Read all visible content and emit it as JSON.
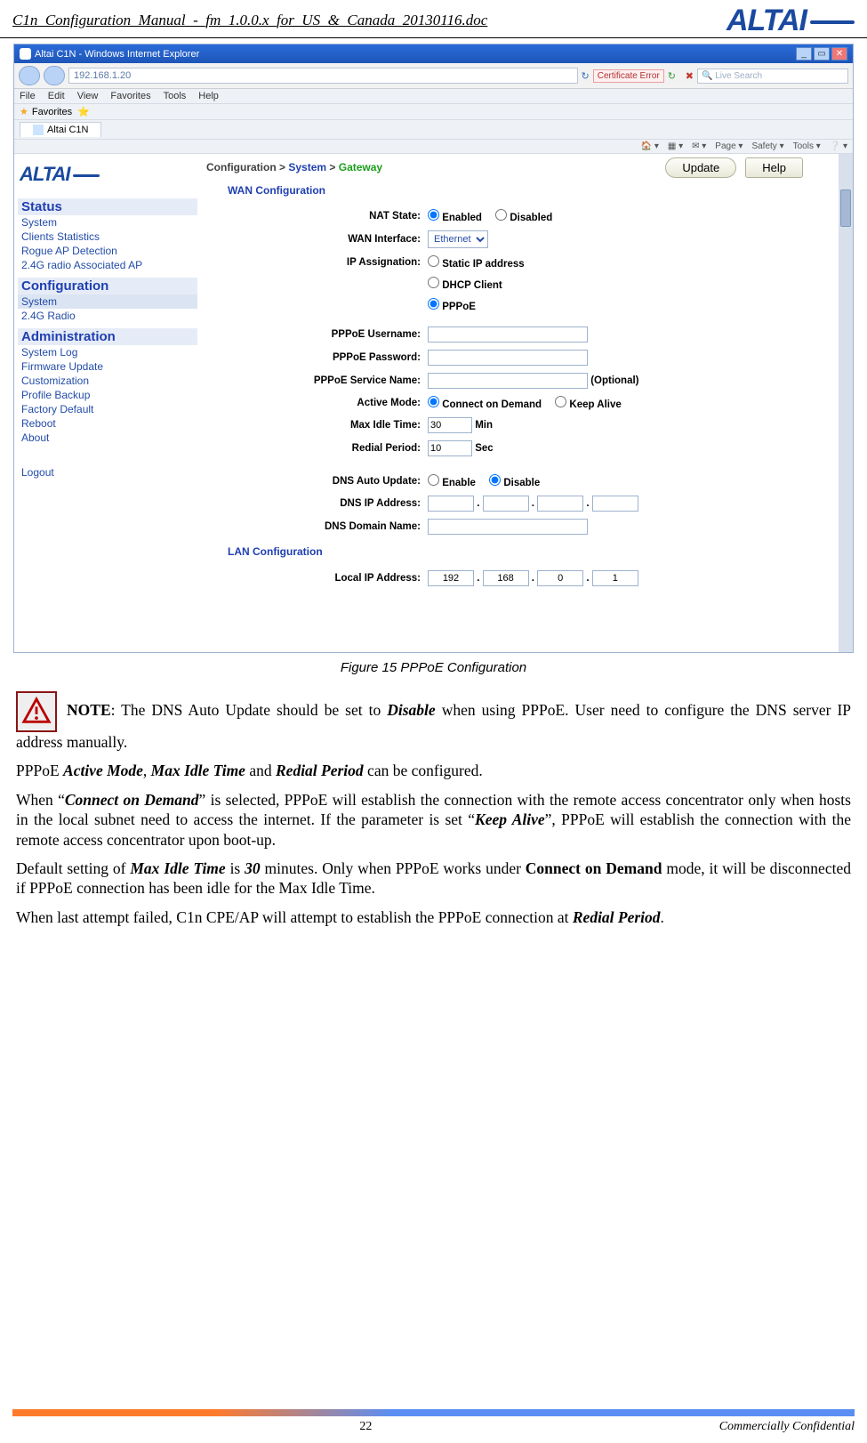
{
  "doc": {
    "header_filename": "C1n_Configuration_Manual_-_fm_1.0.0.x_for_US_&_Canada_20130116.doc",
    "brand": "ALTAI",
    "page_number": "22",
    "footer_right": "Commercially Confidential"
  },
  "ie": {
    "window_title": "Altai C1N - Windows Internet Explorer",
    "address": "192.168.1.20",
    "cert_error": "Certificate Error",
    "search_placeholder": "Live Search",
    "menus": [
      "File",
      "Edit",
      "View",
      "Favorites",
      "Tools",
      "Help"
    ],
    "favorites_label": "Favorites",
    "tab_label": "Altai C1N",
    "toolbar": [
      "Page ▾",
      "Safety ▾",
      "Tools ▾",
      "❔ ▾"
    ]
  },
  "nav": {
    "status_head": "Status",
    "status_items": [
      "System",
      "Clients Statistics",
      "Rogue AP Detection",
      "2.4G radio Associated AP"
    ],
    "config_head": "Configuration",
    "config_items": [
      "System",
      "2.4G Radio"
    ],
    "admin_head": "Administration",
    "admin_items": [
      "System Log",
      "Firmware Update",
      "Customization",
      "Profile Backup",
      "Factory Default",
      "Reboot",
      "About"
    ],
    "logout": "Logout"
  },
  "cfg": {
    "crumb1": "Configuration >",
    "crumb2": "System",
    "crumb3": "Gateway",
    "update_btn": "Update",
    "help_btn": "Help",
    "wan_head": "WAN Configuration",
    "lan_head": "LAN Configuration",
    "labels": {
      "nat": "NAT State:",
      "wanif": "WAN Interface:",
      "ipassign": "IP Assignation:",
      "ppp_user": "PPPoE Username:",
      "ppp_pass": "PPPoE Password:",
      "ppp_svc": "PPPoE Service Name:",
      "active": "Active Mode:",
      "maxidle": "Max Idle Time:",
      "redial": "Redial Period:",
      "dnsauto": "DNS Auto Update:",
      "dnsip": "DNS IP Address:",
      "dnsdom": "DNS Domain Name:",
      "localip": "Local IP Address:"
    },
    "opts": {
      "enabled": "Enabled",
      "disabled": "Disabled",
      "wanif_value": "Ethernet",
      "static": "Static IP address",
      "dhcp": "DHCP Client",
      "pppoe": "PPPoE",
      "optional": "(Optional)",
      "cod": "Connect on Demand",
      "keepalive": "Keep Alive",
      "min": "Min",
      "sec": "Sec",
      "enable": "Enable",
      "disable": "Disable"
    },
    "values": {
      "maxidle": "30",
      "redial": "10",
      "localip": [
        "192",
        "168",
        "0",
        "1"
      ]
    }
  },
  "caption": "Figure 15    PPPoE Configuration",
  "text": {
    "p1a": "NOTE",
    "p1b": ": The DNS Auto Update should be set to ",
    "p1c": "Disable",
    "p1d": " when using PPPoE. User need to configure the DNS server IP address manually.",
    "p2a": "PPPoE ",
    "p2b": "Active Mode",
    "p2c": ", ",
    "p2d": "Max Idle Time",
    "p2e": " and ",
    "p2f": "Redial Period",
    "p2g": " can be configured.",
    "p3a": "When “",
    "p3b": "Connect on Demand",
    "p3c": "” is selected, PPPoE will establish the connection with the remote access concentrator only when hosts in the local subnet need to access the internet. If the parameter is set “",
    "p3d": "Keep Alive",
    "p3e": "”, PPPoE will establish the connection with the remote access concentrator upon boot-up.",
    "p4a": "Default setting of ",
    "p4b": "Max Idle Time",
    "p4c": " is ",
    "p4d": "30",
    "p4e": " minutes. Only when PPPoE works under ",
    "p4f": "Connect on Demand",
    "p4g": " mode, it will be disconnected if PPPoE connection has been idle for the Max Idle Time.",
    "p5a": "When last attempt failed, C1n CPE/AP will attempt to establish the PPPoE connection at ",
    "p5b": "Redial Period",
    "p5c": "."
  }
}
